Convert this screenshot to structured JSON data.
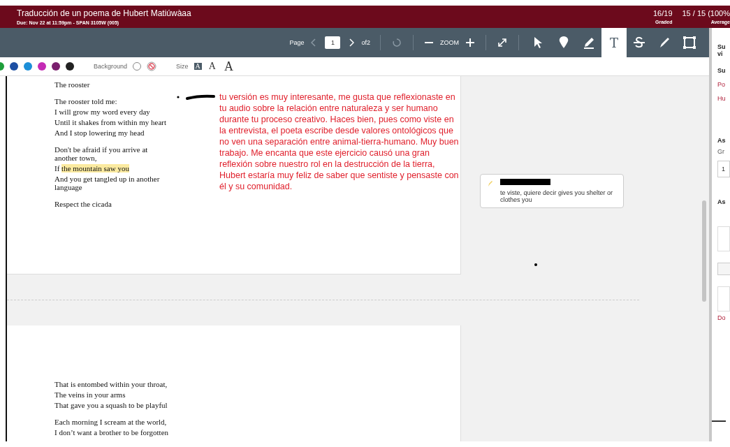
{
  "header": {
    "title": "Traducción de un poema de Hubert Matiúwàaa",
    "due": "Due: Nov 22 at 11:59pm - SPAN 3105W (005)",
    "stats": [
      {
        "value": "16/19",
        "label": "Graded"
      },
      {
        "value": "15 / 15 (100%",
        "label": "Average"
      }
    ]
  },
  "toolbar": {
    "page_label": "Page",
    "page_value": "1",
    "page_total": "of2",
    "zoom_label": "ZOOM",
    "tools": [
      {
        "kind": "select",
        "selected": false
      },
      {
        "kind": "pin",
        "selected": false
      },
      {
        "kind": "highlight",
        "selected": false
      },
      {
        "kind": "text",
        "label": "T",
        "selected": true
      },
      {
        "kind": "strike",
        "selected": false
      },
      {
        "kind": "draw",
        "selected": false
      },
      {
        "kind": "area",
        "selected": false
      }
    ]
  },
  "palette": {
    "colors": [
      {
        "color": "#1e9e3a"
      },
      {
        "color": "#1d4fa3"
      },
      {
        "color": "#1c8fd8"
      },
      {
        "color": "#c42bb5"
      },
      {
        "color": "#7a1f6e"
      },
      {
        "color": "#222222"
      }
    ],
    "background_label": "Background",
    "size_label": "Size",
    "sizes": [
      {
        "label": "A",
        "selected": true
      },
      {
        "label": "A",
        "selected": false
      },
      {
        "label": "A",
        "selected": false
      }
    ]
  },
  "pages": [
    {
      "stanzas": [
        [
          {
            "text": "The rooster"
          }
        ],
        [
          {
            "text": "The rooster told me:"
          },
          {
            "text": "I will grow my word every day"
          },
          {
            "text": "Until it shakes from within my heart"
          },
          {
            "text": "And I stop lowering my head"
          }
        ],
        [
          {
            "text": "Don't be afraid if you arrive at another town,"
          },
          {
            "text": "If",
            "highlight": "the mountain saw you"
          },
          {
            "text": "And you get tangled up in another language"
          }
        ],
        [
          {
            "text": "Respect the cicada"
          }
        ]
      ],
      "comment": "tu versión es muy interesante, me gusta que reflexionaste en tu audio sobre la relación entre naturaleza y ser humano durante tu proceso creativo. Haces bien, pues como viste en la entrevista, el poeta escribe desde valores ontológicos que no ven una separación entre animal-tierra-humano.  Muy buen trabajo. Me encanta que este ejercicio causó una gran reflexión sobre nuestro rol en la destrucción de la tierra, Hubert estaría muy feliz de saber que sentiste y pensaste con él y su comunidad.",
      "note": "te viste, quiere decir  gives you shelter or clothes you"
    },
    {
      "stanzas": [
        [
          {
            "text": "That is entombed within your throat,"
          },
          {
            "text": "The veins in your arms"
          },
          {
            "text": "That gave you a squash to be playful"
          }
        ],
        [
          {
            "text": "Each morning I scream at the world,"
          },
          {
            "text": "I don’t want a brother to be forgotten"
          }
        ]
      ]
    }
  ],
  "sidebar": [
    {
      "kind": "heading",
      "text": "Su"
    },
    {
      "kind": "heading",
      "text": "vi"
    },
    {
      "kind": "heading",
      "text": "Su"
    },
    {
      "kind": "link",
      "text": "Po"
    },
    {
      "kind": "link",
      "text": "Hu"
    },
    {
      "kind": "heading",
      "text": "As"
    },
    {
      "kind": "label",
      "text": "Gr"
    },
    {
      "kind": "field",
      "text": "1"
    },
    {
      "kind": "heading",
      "text": "As"
    },
    {
      "kind": "box"
    },
    {
      "kind": "button"
    },
    {
      "kind": "box"
    },
    {
      "kind": "link",
      "text": "Do"
    }
  ]
}
